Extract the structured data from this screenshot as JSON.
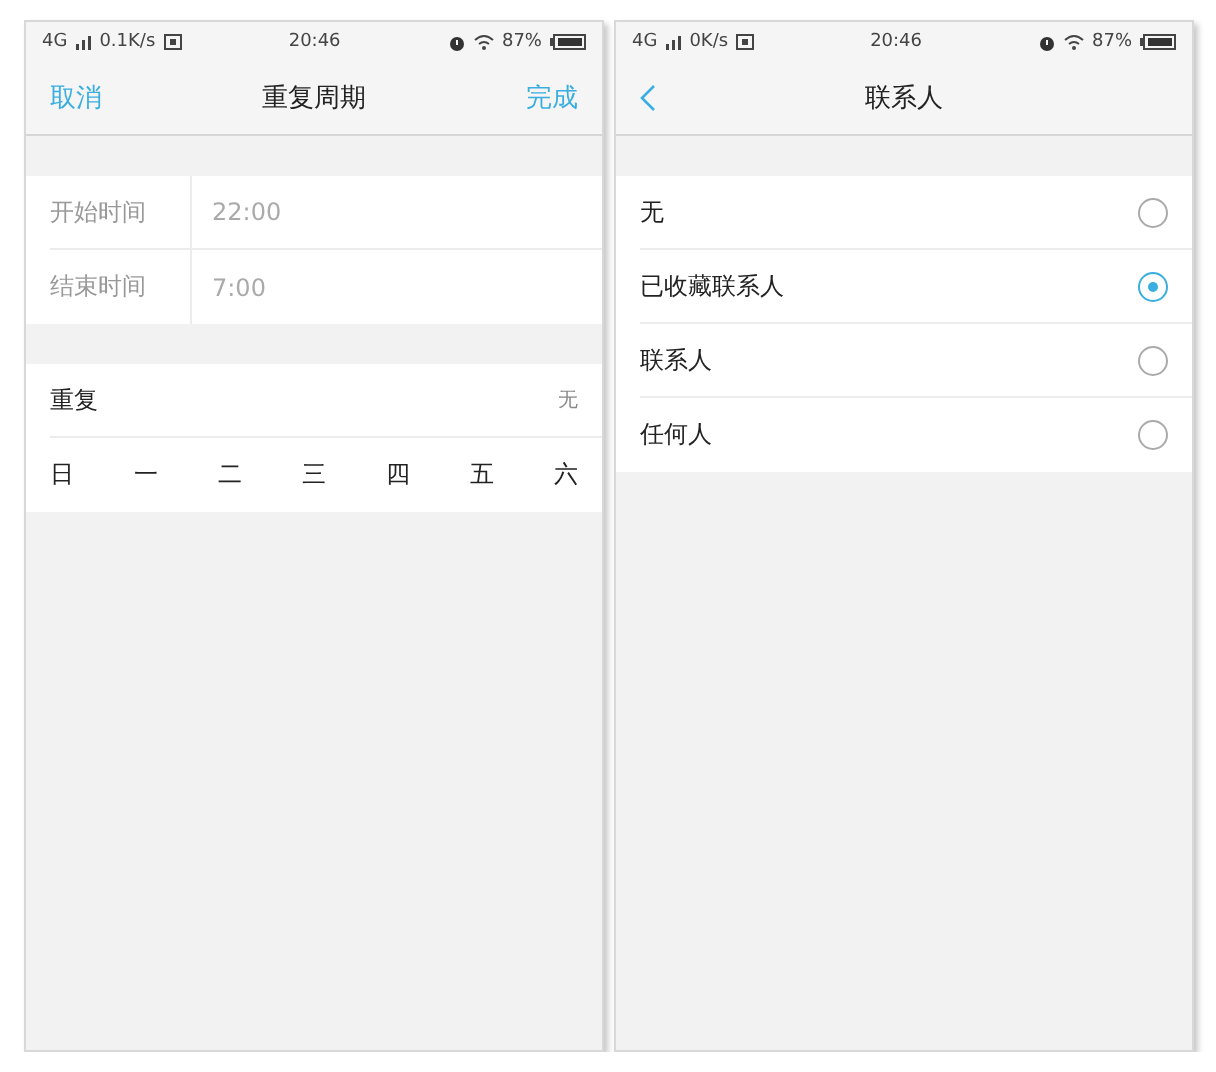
{
  "screens": [
    {
      "kind": "repeat",
      "status_bar": {
        "network": "4G",
        "speed": "0.1K/s",
        "time": "20:46",
        "battery": "87%"
      },
      "nav": {
        "left": "取消",
        "title": "重复周期",
        "right": "完成"
      },
      "time_rows": [
        {
          "label": "开始时间",
          "value": "22:00"
        },
        {
          "label": "结束时间",
          "value": "7:00"
        }
      ],
      "repeat": {
        "label": "重复",
        "value": "无"
      },
      "weekdays": [
        "日",
        "一",
        "二",
        "三",
        "四",
        "五",
        "六"
      ]
    },
    {
      "kind": "contacts",
      "status_bar": {
        "network": "4G",
        "speed": "0K/s",
        "time": "20:46",
        "battery": "87%"
      },
      "nav": {
        "title": "联系人"
      },
      "options": [
        {
          "label": "无",
          "selected": false
        },
        {
          "label": "已收藏联系人",
          "selected": true
        },
        {
          "label": "联系人",
          "selected": false
        },
        {
          "label": "任何人",
          "selected": false
        }
      ]
    }
  ]
}
